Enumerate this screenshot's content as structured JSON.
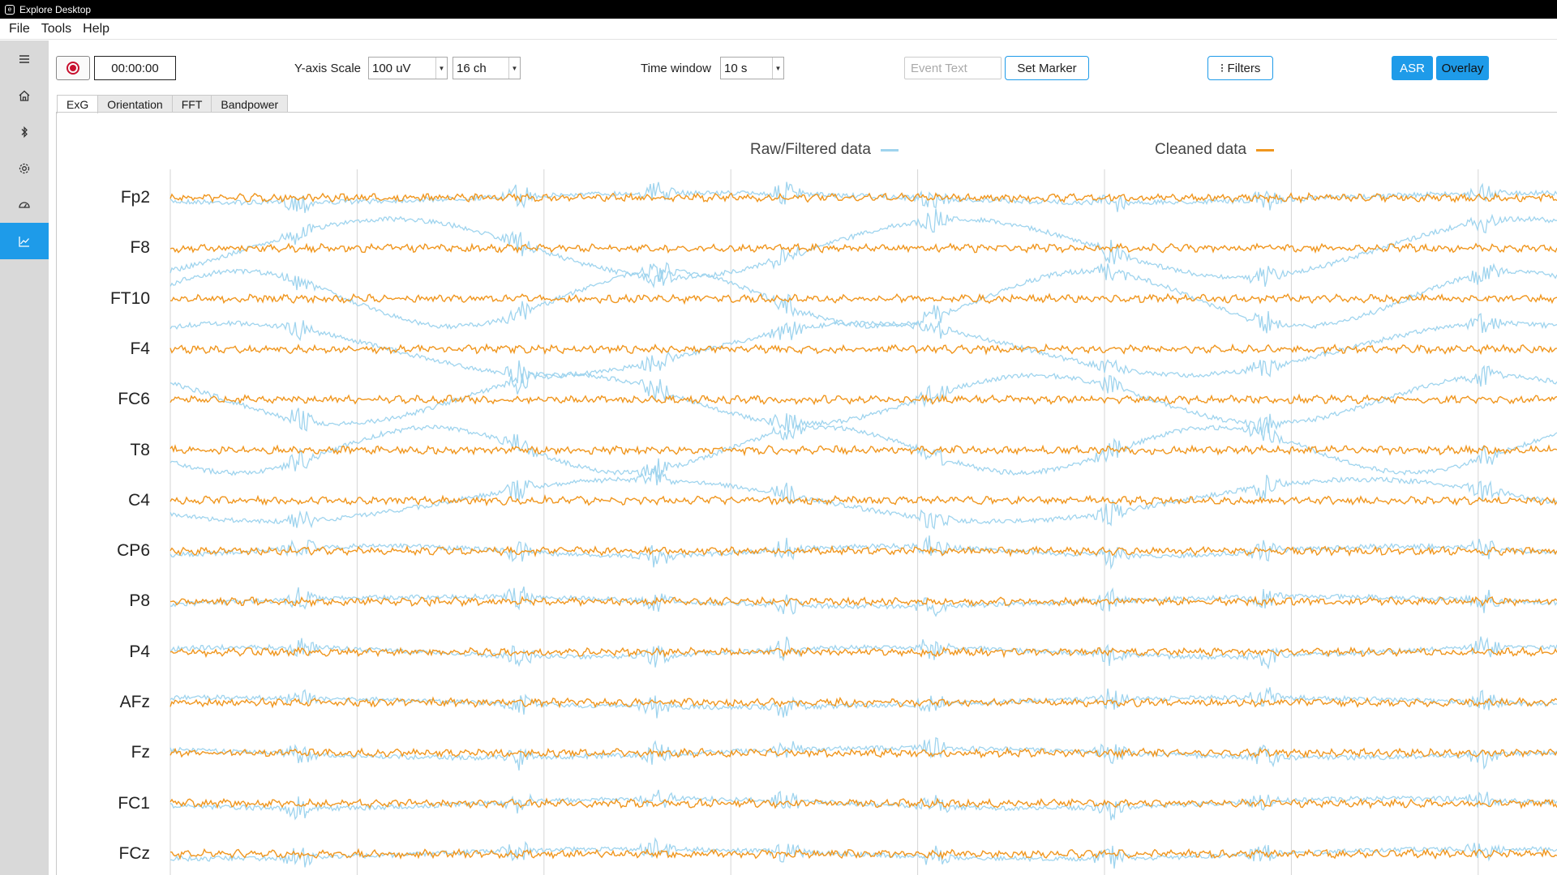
{
  "window": {
    "title": "Explore Desktop"
  },
  "menu": [
    "File",
    "Tools",
    "Help"
  ],
  "sidebar": {
    "items": [
      {
        "icon": "hamburger-menu-icon"
      },
      {
        "icon": "home-icon"
      },
      {
        "icon": "bluetooth-icon"
      },
      {
        "icon": "gear-icon"
      },
      {
        "icon": "gauge-icon"
      },
      {
        "icon": "chart-icon",
        "active": true
      }
    ]
  },
  "toolbar": {
    "timer": "00:00:00",
    "y_scale_label": "Y-axis Scale",
    "y_scale_value": "100 uV",
    "channels_value": "16 ch",
    "time_window_label": "Time window",
    "time_window_value": "10 s",
    "event_text_placeholder": "Event Text",
    "set_marker_label": "Set Marker",
    "filters_label": "⁝ Filters",
    "asr_label": "ASR",
    "overlay_label": "Overlay"
  },
  "tabs": [
    "ExG",
    "Orientation",
    "FFT",
    "Bandpower"
  ],
  "active_tab": "ExG",
  "plot": {
    "legend": [
      {
        "label": "Raw/Filtered data",
        "color": "#9fd4ee"
      },
      {
        "label": "Cleaned data",
        "color": "#f0961e"
      }
    ],
    "channels": [
      "Fp2",
      "F8",
      "FT10",
      "F4",
      "FC6",
      "T8",
      "C4",
      "CP6",
      "P8",
      "P4",
      "AFz",
      "Fz",
      "FC1",
      "FCz"
    ]
  },
  "colors": {
    "accent": "#1e9be9",
    "raw": "#9fd4ee",
    "cleaned": "#f0961e"
  }
}
